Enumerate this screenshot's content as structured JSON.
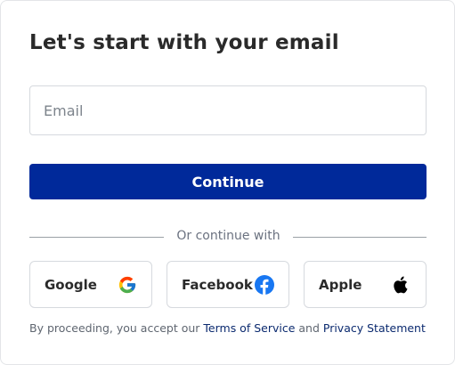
{
  "form": {
    "title": "Let's start with your email",
    "email_placeholder": "Email",
    "email_value": "",
    "continue_label": "Continue"
  },
  "divider": {
    "text": "Or continue with"
  },
  "social": {
    "google_label": "Google",
    "facebook_label": "Facebook",
    "apple_label": "Apple"
  },
  "legal": {
    "prefix": "By proceeding, you accept our ",
    "terms_link": "Terms of Service",
    "conjunction": " and ",
    "privacy_link": "Privacy Statement"
  },
  "colors": {
    "primary_button": "#00299a",
    "facebook_blue": "#1877f2",
    "link": "#0b2a6f"
  },
  "icons": {
    "google": "google-icon",
    "facebook": "facebook-icon",
    "apple": "apple-icon"
  }
}
